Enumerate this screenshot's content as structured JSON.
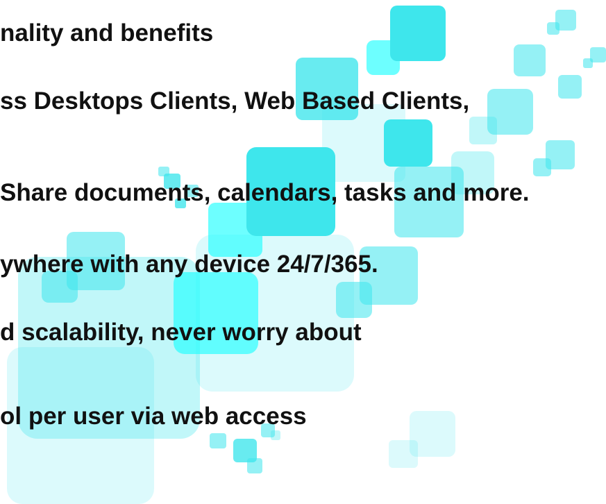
{
  "lines": [
    "nality and benefits",
    "ss Desktops Clients, Web Based Clients,",
    "Share documents, calendars, tasks and more.",
    "ywhere with any device 24/7/365.",
    "d scalability, never worry about",
    "ol per user via web access"
  ],
  "colors": {
    "accent": "#3ee6ec",
    "text": "#111111",
    "background": "#ffffff"
  }
}
